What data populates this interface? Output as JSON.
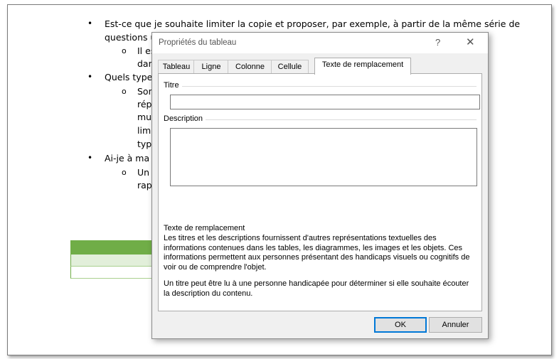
{
  "document": {
    "bullets": [
      {
        "kind": "bullet",
        "text": "Est-ce que je souhaite limiter la copie et proposer, par exemple, à partir de la même série de"
      },
      {
        "kind": "cont",
        "text": "questions u"
      },
      {
        "kind": "sub",
        "text": "Il es"
      },
      {
        "kind": "cont2",
        "text": "dan"
      },
      {
        "kind": "bullet",
        "text": "Quels types"
      },
      {
        "kind": "sub",
        "text": "Son"
      },
      {
        "kind": "cont2",
        "text": "répo"
      },
      {
        "kind": "cont2",
        "text": "mul"
      },
      {
        "kind": "cont2",
        "text": "limi"
      },
      {
        "kind": "cont2",
        "text": "type"
      },
      {
        "kind": "bullet",
        "text": "Ai-je à ma d"
      },
      {
        "kind": "sub",
        "text": "Un r"
      },
      {
        "kind": "cont2",
        "text": "rapi"
      }
    ],
    "bullet_glyph": "•",
    "sub_glyph": "o"
  },
  "dialog": {
    "title": "Propriétés du tableau",
    "help_glyph": "?",
    "close_glyph": "✕",
    "tabs": [
      {
        "label": "Tableau",
        "active": false
      },
      {
        "label": "Ligne",
        "active": false
      },
      {
        "label": "Colonne",
        "active": false
      },
      {
        "label": "Cellule",
        "active": false
      },
      {
        "label": "Texte de remplacement",
        "active": true
      }
    ],
    "title_label": "Titre",
    "title_value": "",
    "description_label": "Description",
    "description_value": "",
    "help_heading": "Texte de remplacement",
    "help_para1": "Les titres et les descriptions fournissent d'autres représentations textuelles des informations contenues dans les tables, les diagrammes, les images et les objets. Ces informations permettent aux personnes présentant des handicaps visuels ou cognitifs de voir ou de comprendre l'objet.",
    "help_para2": "Un titre peut être lu à une personne handicapée pour déterminer si elle souhaite écouter la description du contenu.",
    "ok_label": "OK",
    "cancel_label": "Annuler"
  },
  "colors": {
    "accent": "#0078d7",
    "table_header": "#70ad47",
    "table_band": "#e2efda"
  }
}
